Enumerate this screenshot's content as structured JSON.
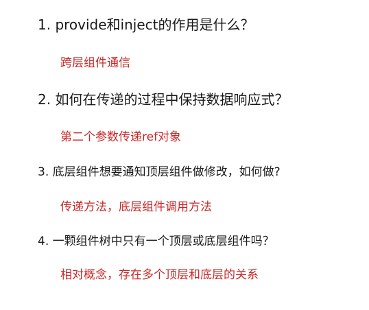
{
  "items": [
    {
      "question": "1. provide和inject的作用是什么？",
      "answer": "跨层组件通信"
    },
    {
      "question": "2. 如何在传递的过程中保持数据响应式？",
      "answer": "第二个参数传递ref对象"
    },
    {
      "question": "3.  底层组件想要通知顶层组件做修改，如何做?",
      "answer": "传递方法，底层组件调用方法"
    },
    {
      "question": "4. 一颗组件树中只有一个顶层或底层组件吗？",
      "answer": "相对概念，存在多个顶层和底层的关系"
    }
  ]
}
